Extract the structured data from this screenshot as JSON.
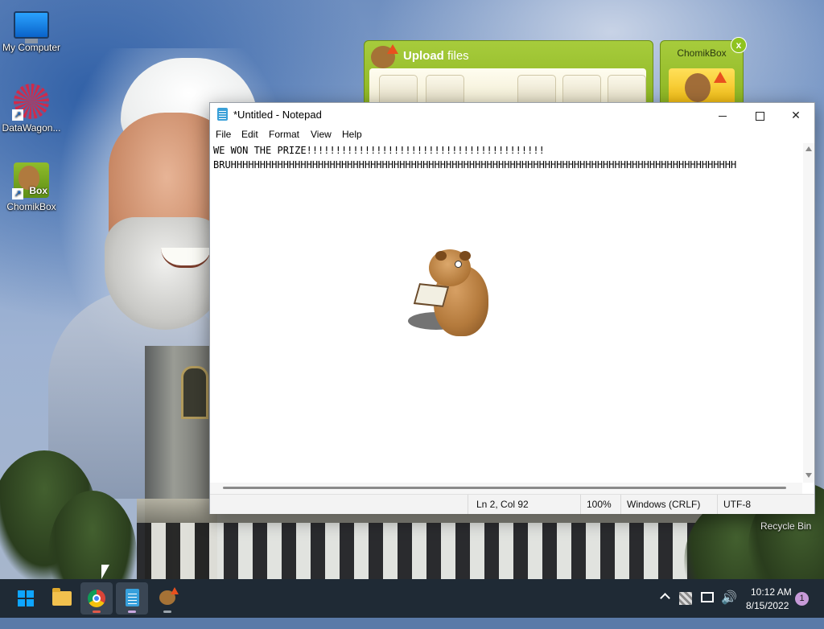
{
  "desktop": {
    "icons": [
      {
        "label": "My Computer"
      },
      {
        "label": "DataWagon..."
      },
      {
        "label": "ChomikBox",
        "badge_text": "Box"
      }
    ],
    "recycle_bin_label": "Recycle Bin"
  },
  "chomikbox": {
    "upload_title_bold": "Upload",
    "upload_title_rest": " files",
    "panel_title": "ChomikBox",
    "close_glyph": "x",
    "accent_color": "#8cb422"
  },
  "notepad": {
    "title": "*Untitled - Notepad",
    "menu": [
      "File",
      "Edit",
      "Format",
      "View",
      "Help"
    ],
    "lines": [
      "WE WON THE PRIZE!!!!!!!!!!!!!!!!!!!!!!!!!!!!!!!!!!!!!!!!!",
      "BRUHHHHHHHHHHHHHHHHHHHHHHHHHHHHHHHHHHHHHHHHHHHHHHHHHHHHHHHHHHHHHHHHHHHHHHHHHHHHHHHHHHHHHHH"
    ],
    "status": {
      "position": "Ln 2, Col 92",
      "zoom": "100%",
      "line_ending": "Windows (CRLF)",
      "encoding": "UTF-8"
    },
    "close_glyph": "✕"
  },
  "taskbar": {
    "apps": [
      "start-icon",
      "file-explorer-icon",
      "chrome-icon",
      "notepad-icon",
      "chomikbox-icon"
    ],
    "clock_time": "10:12 AM",
    "clock_date": "8/15/2022",
    "notification_count": "1",
    "volume_glyph": "🔊"
  }
}
